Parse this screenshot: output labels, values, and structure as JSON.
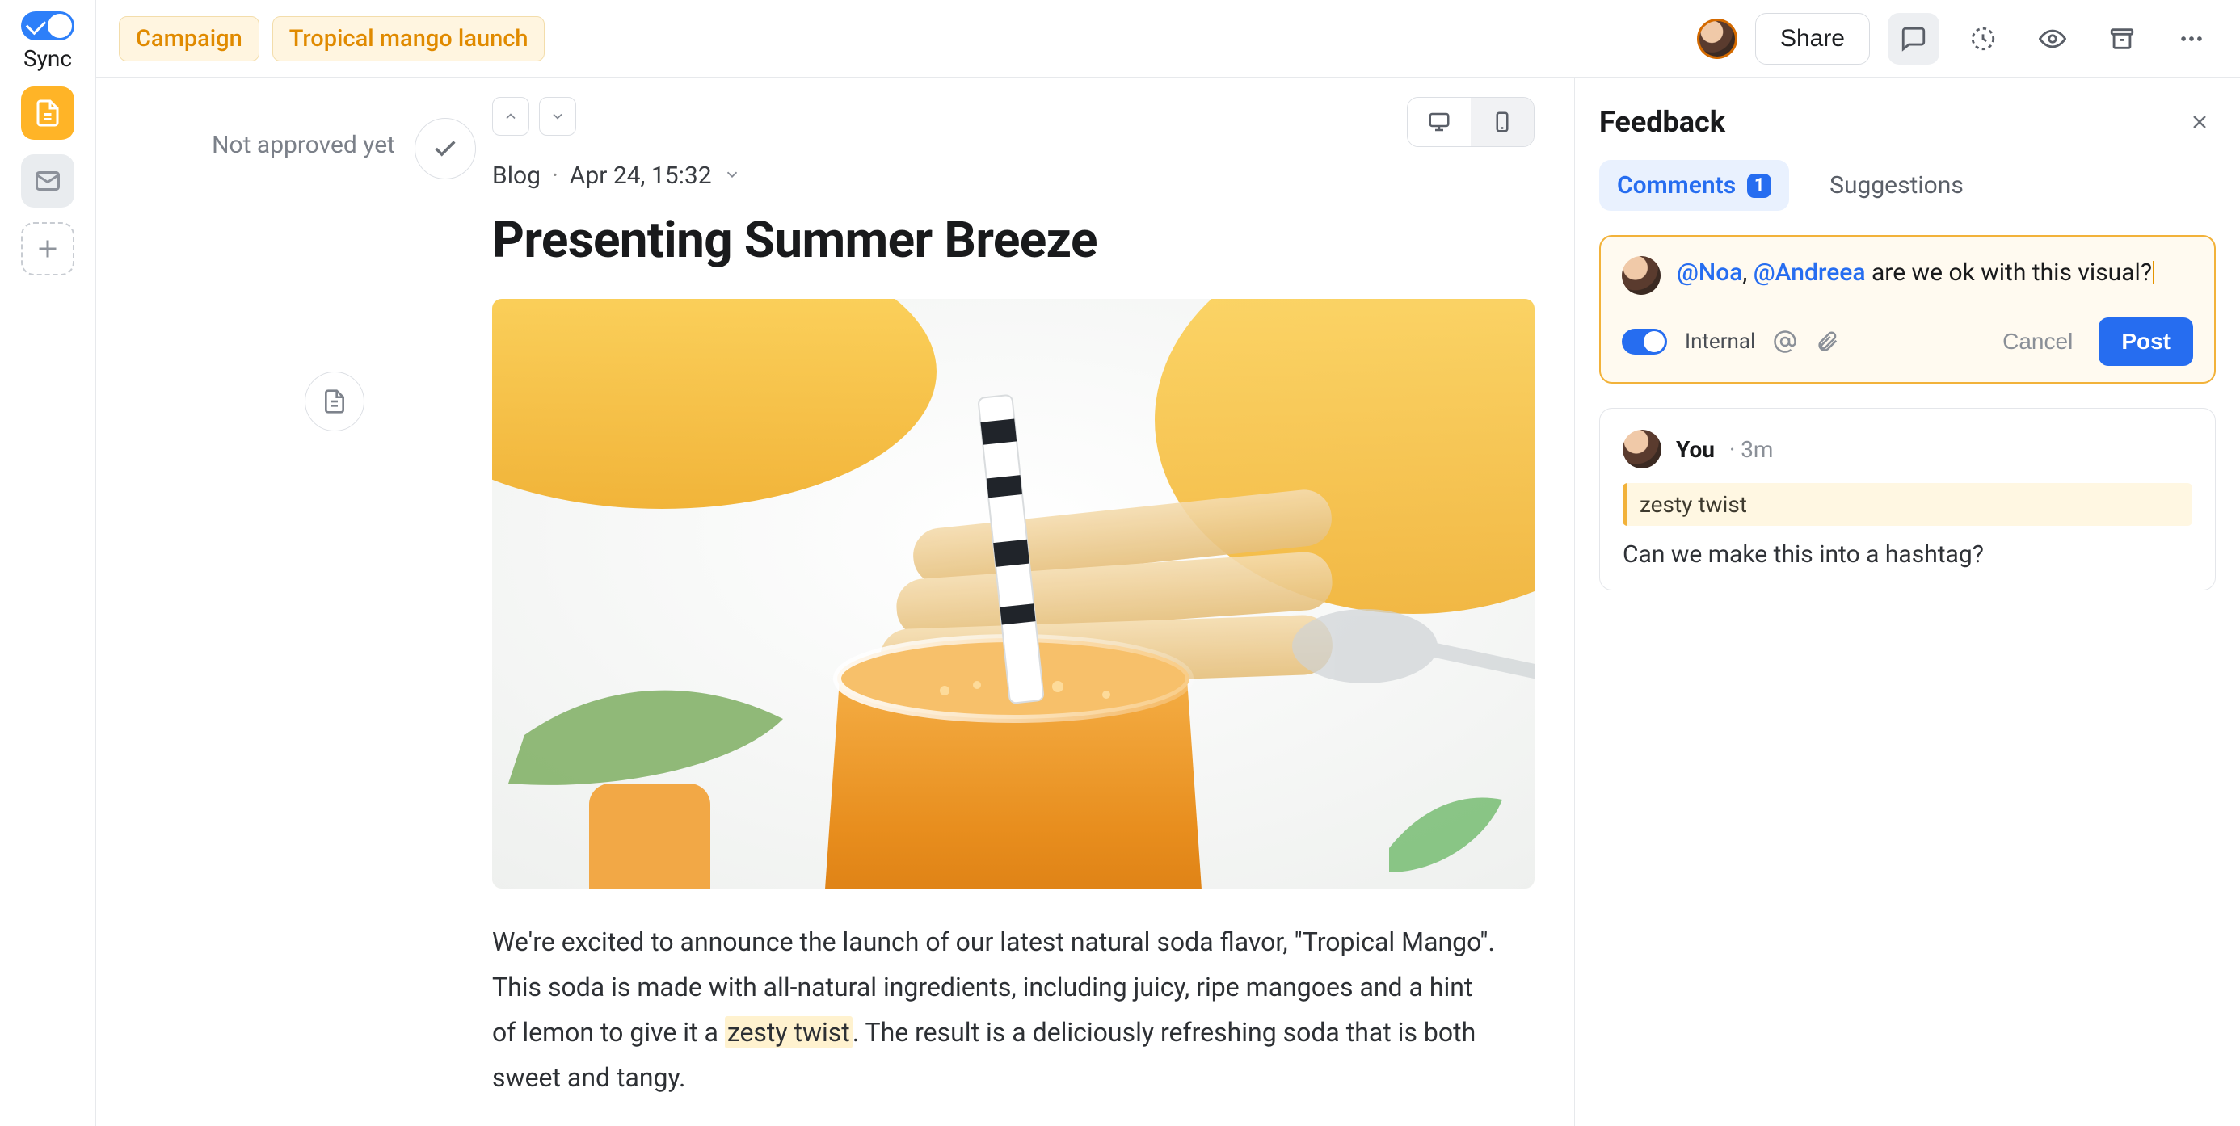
{
  "rail": {
    "sync_label": "Sync"
  },
  "topbar": {
    "tags": [
      "Campaign",
      "Tropical mango launch"
    ],
    "share_label": "Share"
  },
  "approval": {
    "status_text": "Not approved yet"
  },
  "doc": {
    "kind": "Blog",
    "timestamp": "Apr 24, 15:32",
    "title": "Presenting Summer Breeze",
    "paragraph_pre": "We're excited to announce the launch of our latest natural soda flavor, \"Tropical Mango\". This soda is made with all-natural ingredients, including juicy, ripe mangoes and a hint of lemon to give it a ",
    "paragraph_hl": "zesty twist",
    "paragraph_post": ". The result is a deliciously refreshing soda that is both sweet and tangy."
  },
  "panel": {
    "title": "Feedback",
    "tabs": {
      "comments_label": "Comments",
      "comments_count": "1",
      "suggestions_label": "Suggestions"
    },
    "composer": {
      "mention1": "@Noa",
      "sep": ", ",
      "mention2": "@Andreea",
      "rest": " are we ok with this visual?",
      "internal_label": "Internal",
      "cancel_label": "Cancel",
      "post_label": "Post"
    },
    "comment": {
      "author": "You",
      "time": "· 3m",
      "quote": "zesty twist",
      "body": "Can we make this into a hashtag?"
    }
  }
}
